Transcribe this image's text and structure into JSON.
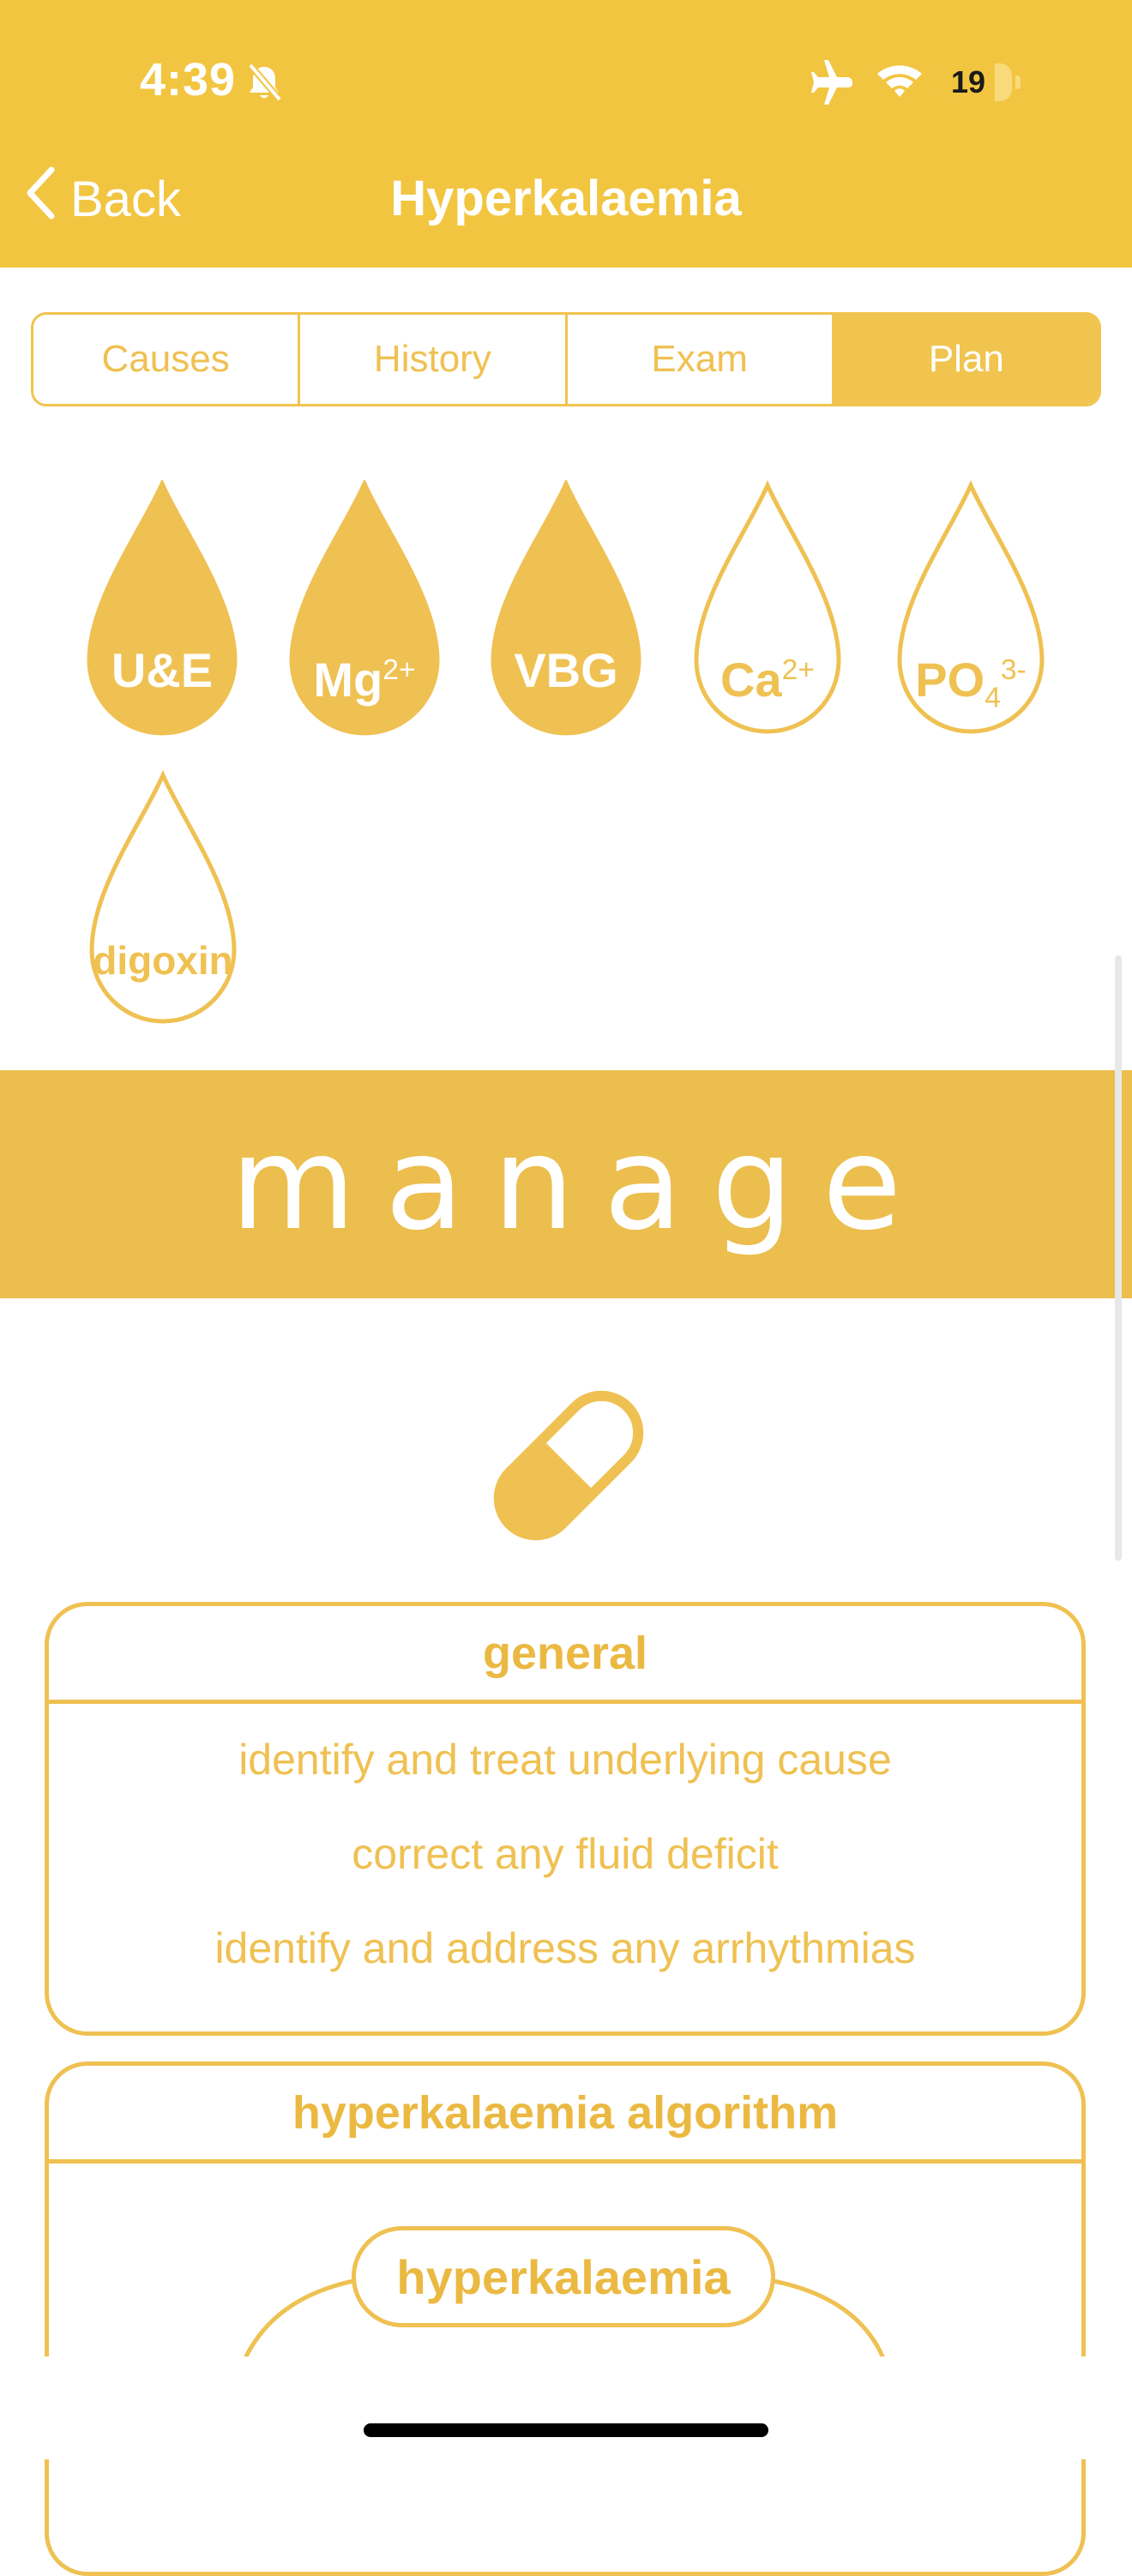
{
  "status_bar": {
    "time": "4:39",
    "battery": "19",
    "icons": [
      "bell-slash-icon",
      "airplane-icon",
      "wifi-icon",
      "battery-icon"
    ]
  },
  "nav": {
    "back_label": "Back",
    "title": "Hyperkalaemia"
  },
  "tabs": [
    {
      "label": "Causes",
      "selected": false
    },
    {
      "label": "History",
      "selected": false
    },
    {
      "label": "Exam",
      "selected": false
    },
    {
      "label": "Plan",
      "selected": true
    }
  ],
  "investigations": [
    {
      "base": "U&E",
      "sup": "",
      "sub": "",
      "filled": true
    },
    {
      "base": "Mg",
      "sup": "2+",
      "sub": "",
      "filled": true
    },
    {
      "base": "VBG",
      "sup": "",
      "sub": "",
      "filled": true
    },
    {
      "base": "Ca",
      "sup": "2+",
      "sub": "",
      "filled": false
    },
    {
      "base": "PO",
      "sup": "3-",
      "sub": "4",
      "filled": false
    },
    {
      "base": "digoxin",
      "sup": "",
      "sub": "",
      "filled": false
    }
  ],
  "banner": {
    "text": "manage"
  },
  "section_icon": "pill-capsule-icon",
  "general_card": {
    "title": "general",
    "lines": [
      "identify and treat underlying cause",
      "correct any fluid deficit",
      "identify and address any arrhythmias"
    ]
  },
  "algorithm_card": {
    "title": "hyperkalaemia algorithm",
    "root_node": "hyperkalaemia"
  },
  "colors": {
    "header": "#F2C541",
    "accent": "#EFC152",
    "banner": "#EBBE4E",
    "text_on_accent": "#FFFFFF"
  }
}
